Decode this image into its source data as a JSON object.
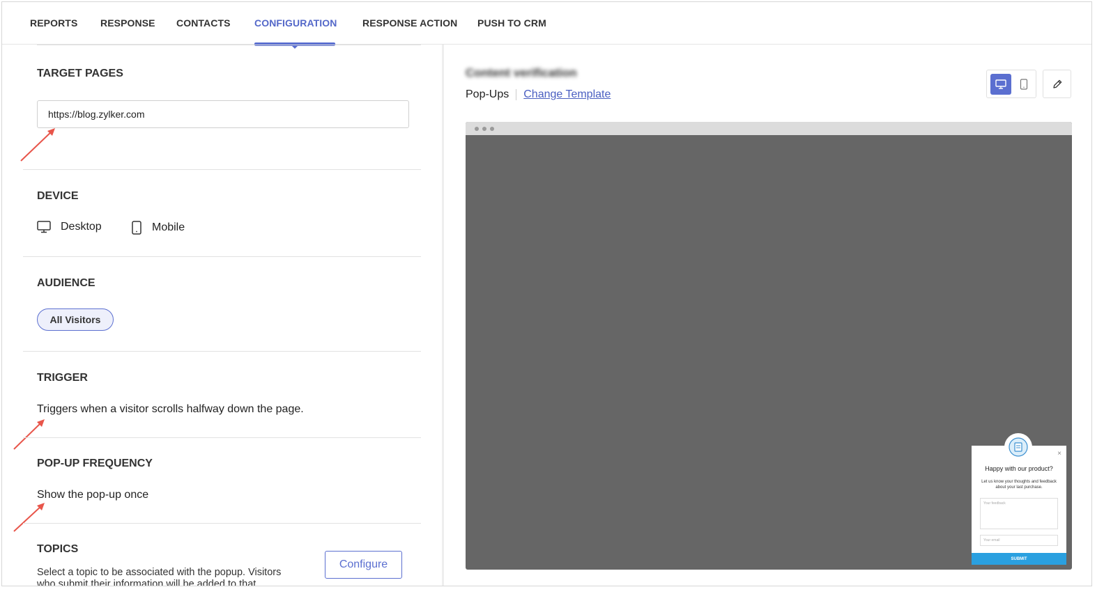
{
  "tabs": [
    {
      "label": "REPORTS"
    },
    {
      "label": "RESPONSE"
    },
    {
      "label": "CONTACTS"
    },
    {
      "label": "CONFIGURATION",
      "active": true
    },
    {
      "label": "RESPONSE ACTION"
    },
    {
      "label": "PUSH TO CRM"
    }
  ],
  "colors": {
    "accent": "#5b6fd0",
    "arrow": "#e8554a",
    "preview_bg": "#666666",
    "submit": "#2aa0e0"
  },
  "target_pages": {
    "title": "TARGET PAGES",
    "url": "https://blog.zylker.com"
  },
  "device": {
    "title": "DEVICE",
    "desktop": "Desktop",
    "mobile": "Mobile"
  },
  "audience": {
    "title": "AUDIENCE",
    "pill": "All Visitors"
  },
  "trigger": {
    "title": "TRIGGER",
    "text": "Triggers when a visitor scrolls halfway down the page."
  },
  "frequency": {
    "title": "POP-UP FREQUENCY",
    "text": "Show the pop-up once"
  },
  "topics": {
    "title": "TOPICS",
    "text": "Select a topic to be associated with the popup. Visitors who submit their information will be added to that",
    "button": "Configure"
  },
  "preview": {
    "title": "Content verification",
    "type": "Pop-Ups",
    "change_template": "Change Template",
    "popup": {
      "title": "Happy with our product?",
      "desc": "Let us know your thoughts and feedback about your last purchase.",
      "feedback_placeholder": "Your feedback",
      "email_placeholder": "Your email",
      "submit": "SUBMIT",
      "close": "×"
    }
  }
}
